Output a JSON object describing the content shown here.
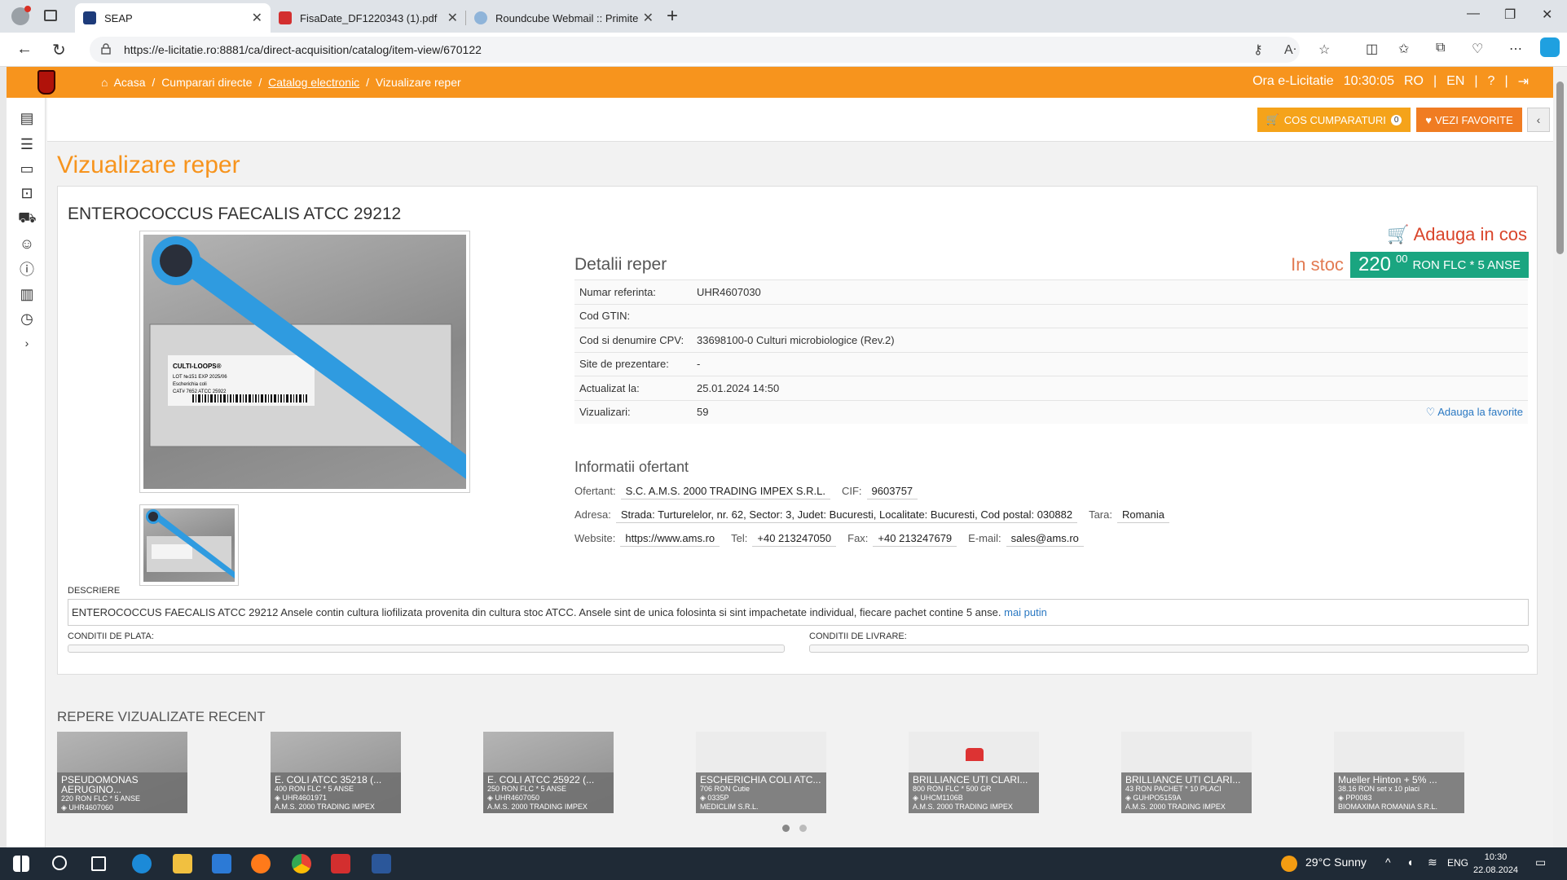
{
  "browser": {
    "tabs": [
      {
        "title": "SEAP",
        "active": true,
        "icon": "seap-favicon"
      },
      {
        "title": "FisaDate_DF1220343 (1).pdf",
        "active": false,
        "icon": "pdf-icon"
      },
      {
        "title": "Roundcube Webmail :: Primite",
        "active": false,
        "icon": "roundcube-icon"
      }
    ],
    "url": "https://e-licitatie.ro:8881/ca/direct-acquisition/catalog/item-view/670122"
  },
  "topnav": {
    "breadcrumbs": [
      {
        "label": "Acasa"
      },
      {
        "label": "Cumparari directe"
      },
      {
        "label": "Catalog electronic"
      },
      {
        "label": "Vizualizare reper"
      }
    ],
    "clock_label": "Ora e-Licitatie",
    "clock_value": "10:30:05",
    "lang_ro": "RO",
    "lang_en": "EN"
  },
  "toolbar": {
    "cart_label": "COS CUMPARATURI",
    "cart_count": "0",
    "fav_label": "VEZI FAVORITE"
  },
  "page": {
    "title": "Vizualizare reper"
  },
  "item": {
    "name": "ENTEROCOCCUS FAECALIS ATCC 29212",
    "add_to_cart": "Adauga in cos",
    "details_heading": "Detalii reper",
    "stock_label": "In stoc",
    "price_int": "220",
    "price_dec": "00",
    "price_unit": "RON FLC * 5 ANSE",
    "details": [
      {
        "label": "Numar referinta:",
        "value": "UHR4607030"
      },
      {
        "label": "Cod GTIN:",
        "value": ""
      },
      {
        "label": "Cod si denumire CPV:",
        "value": "33698100-0 Culturi microbiologice (Rev.2)"
      },
      {
        "label": "Site de prezentare:",
        "value": "-"
      },
      {
        "label": "Actualizat la:",
        "value": "25.01.2024 14:50"
      },
      {
        "label": "Vizualizari:",
        "value": "59"
      }
    ],
    "add_favorite": "Adauga la favorite",
    "image_text": {
      "brand": "CULTI-LOOPS®",
      "lot": "LOT №151  EXP 2025/06",
      "organism": "Escherichia coli",
      "cat": "CAT# 7652    ATCC 25922"
    }
  },
  "offerer": {
    "heading": "Informatii ofertant",
    "ofertant_label": "Ofertant:",
    "ofertant": "S.C. A.M.S. 2000 TRADING IMPEX S.R.L.",
    "cif_label": "CIF:",
    "cif": "9603757",
    "adresa_label": "Adresa:",
    "adresa": "Strada: Turturelelor, nr. 62, Sector: 3, Judet: Bucuresti, Localitate: Bucuresti, Cod postal: 030882",
    "tara_label": "Tara:",
    "tara": "Romania",
    "website_label": "Website:",
    "website": "https://www.ams.ro",
    "tel_label": "Tel:",
    "tel": "+40 213247050",
    "fax_label": "Fax:",
    "fax": "+40 213247679",
    "email_label": "E-mail:",
    "email": "sales@ams.ro"
  },
  "description": {
    "label": "DESCRIERE",
    "text": "ENTEROCOCCUS FAECALIS ATCC 29212 Ansele contin cultura liofilizata provenita din cultura stoc ATCC. Ansele sint de unica folosinta si sint impachetate individual, fiecare pachet contine 5 anse.",
    "less_link": "mai putin",
    "payment_label": "CONDITII DE PLATA:",
    "delivery_label": "CONDITII DE LIVRARE:"
  },
  "recent": {
    "heading": "REPERE VIZUALIZATE RECENT",
    "items": [
      {
        "title": "PSEUDOMONAS\nAERUGINO...",
        "price": "220 RON FLC * 5 ANSE",
        "code": "UHR4607060",
        "vendor": ""
      },
      {
        "title": "E. COLI ATCC 35218 (...",
        "price": "400 RON FLC * 5 ANSE",
        "code": "UHR4601971",
        "vendor": "A.M.S. 2000 TRADING IMPEX"
      },
      {
        "title": "E. COLI ATCC 25922 (...",
        "price": "250 RON FLC * 5 ANSE",
        "code": "UHR4607050",
        "vendor": "A.M.S. 2000 TRADING IMPEX"
      },
      {
        "title": "ESCHERICHIA COLI ATC...",
        "price": "706 RON Cutie",
        "code": "0335P",
        "vendor": "MEDICLIM S.R.L."
      },
      {
        "title": "BRILLIANCE UTI CLARI...",
        "price": "800 RON FLC * 500 GR",
        "code": "UHCM1106B",
        "vendor": "A.M.S. 2000 TRADING IMPEX"
      },
      {
        "title": "BRILLIANCE UTI CLARI...",
        "price": "43 RON PACHET * 10 PLACI",
        "code": "GUHPO5159A",
        "vendor": "A.M.S. 2000 TRADING IMPEX"
      },
      {
        "title": "Mueller Hinton + 5% ...",
        "price": "38.16 RON set x 10 placi",
        "code": "PP0083",
        "vendor": "BIOMAXIMA ROMANIA S.R.L."
      }
    ]
  },
  "taskbar": {
    "weather": "29°C  Sunny",
    "lang": "ENG",
    "time": "10:30",
    "date": "22.08.2024"
  },
  "colors": {
    "brand_orange": "#f7941d",
    "price_green": "#1aa580",
    "cart_red": "#d9452b"
  }
}
